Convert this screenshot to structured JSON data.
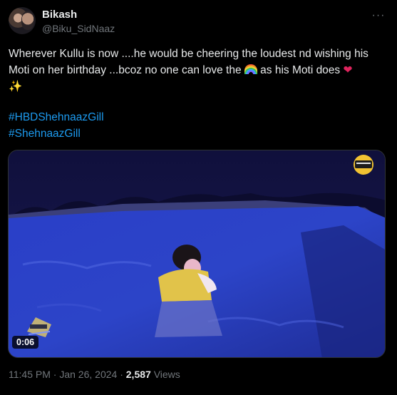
{
  "author": {
    "name": "Bikash",
    "handle": "@Biku_SidNaaz"
  },
  "more_icon": "ellipsis-icon",
  "text": {
    "part1": "Wherever Kullu is now ....he would be cheering the loudest nd wishing his Moti on her birthday ...bcoz no one can love the ",
    "part2": " as his Moti does "
  },
  "emojis": [
    "rainbow-icon",
    "red-heart-icon",
    "sparkles-icon"
  ],
  "hashtags": [
    "#HBDShehnaazGill",
    "#ShehnaazGill"
  ],
  "video": {
    "duration": "0:06"
  },
  "meta": {
    "time": "11:45 PM",
    "separator": " · ",
    "date": "Jan 26, 2024",
    "views_count": "2,587",
    "views_label": " Views"
  },
  "colors": {
    "background": "#000000",
    "text": "#e7e9ea",
    "muted": "#71767b",
    "link": "#1d9bf0",
    "heart": "#e0245e"
  }
}
